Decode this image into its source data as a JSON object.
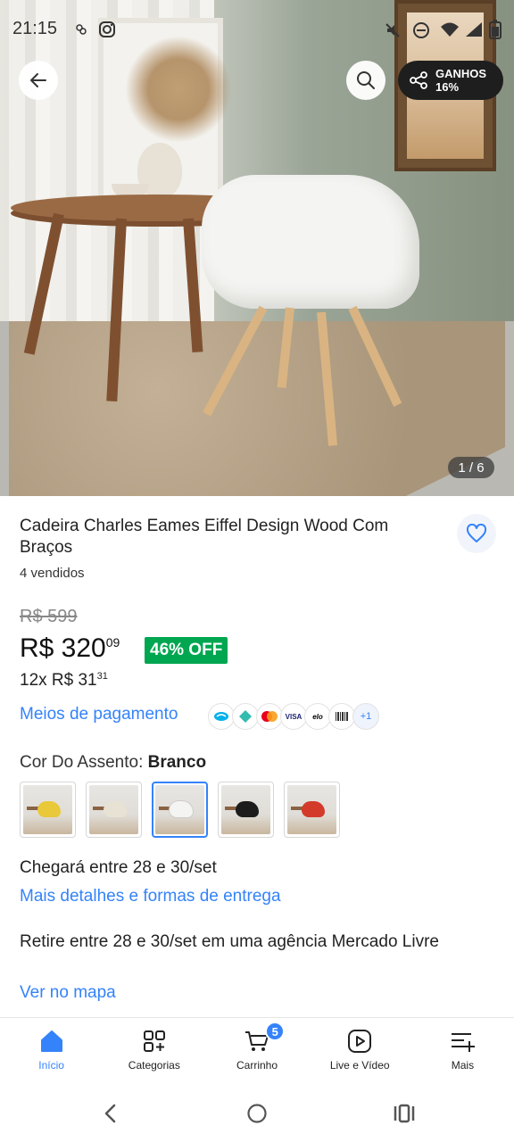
{
  "status_bar": {
    "time": "21:15",
    "icons": [
      "sim-icon",
      "instagram-icon",
      "mute-icon",
      "dnd-icon",
      "wifi-icon",
      "signal-icon",
      "battery-icon"
    ]
  },
  "hero": {
    "back_icon": "arrow-left-icon",
    "search_icon": "search-icon",
    "share_icon": "share-icon",
    "share_line1": "GANHOS",
    "share_line2": "16%",
    "image_counter": "1 / 6"
  },
  "product": {
    "title": "Cadeira Charles Eames Eiffel Design Wood Com Braços",
    "sold": "4 vendidos",
    "old_price": "R$ 599",
    "price_main": "R$ 320",
    "price_cents": "09",
    "discount": "46% OFF",
    "installments_main": "12x R$ 31",
    "installments_cents": "31",
    "payment_link": "Meios de pagamento",
    "payment_methods": [
      "mercado-pago",
      "pix",
      "mastercard",
      "VISA",
      "elo",
      "boleto"
    ],
    "payment_more": "+1",
    "color_label": "Cor Do Assento:",
    "color_value": "Branco",
    "swatches": [
      {
        "color": "#e9c83a",
        "name": "Amarelo"
      },
      {
        "color": "#e7e2d3",
        "name": "Bege"
      },
      {
        "color": "#f4f4f2",
        "name": "Branco",
        "selected": true
      },
      {
        "color": "#1c1c1c",
        "name": "Preto"
      },
      {
        "color": "#d33a2a",
        "name": "Vermelho"
      }
    ],
    "delivery": "Chegará entre 28 e 30/set",
    "delivery_link": "Mais detalhes e formas de entrega",
    "pickup": "Retire entre 28 e 30/set em uma agência Mercado Livre",
    "map_link": "Ver no mapa"
  },
  "bottom_nav": {
    "items": [
      {
        "label": "Início",
        "icon": "home-icon",
        "active": true
      },
      {
        "label": "Categorias",
        "icon": "categories-icon"
      },
      {
        "label": "Carrinho",
        "icon": "cart-icon",
        "badge": "5"
      },
      {
        "label": "Live e Vídeo",
        "icon": "play-icon"
      },
      {
        "label": "Mais",
        "icon": "menu-plus-icon"
      }
    ]
  },
  "colors": {
    "accent": "#3483fa",
    "discount_green": "#00a650"
  }
}
